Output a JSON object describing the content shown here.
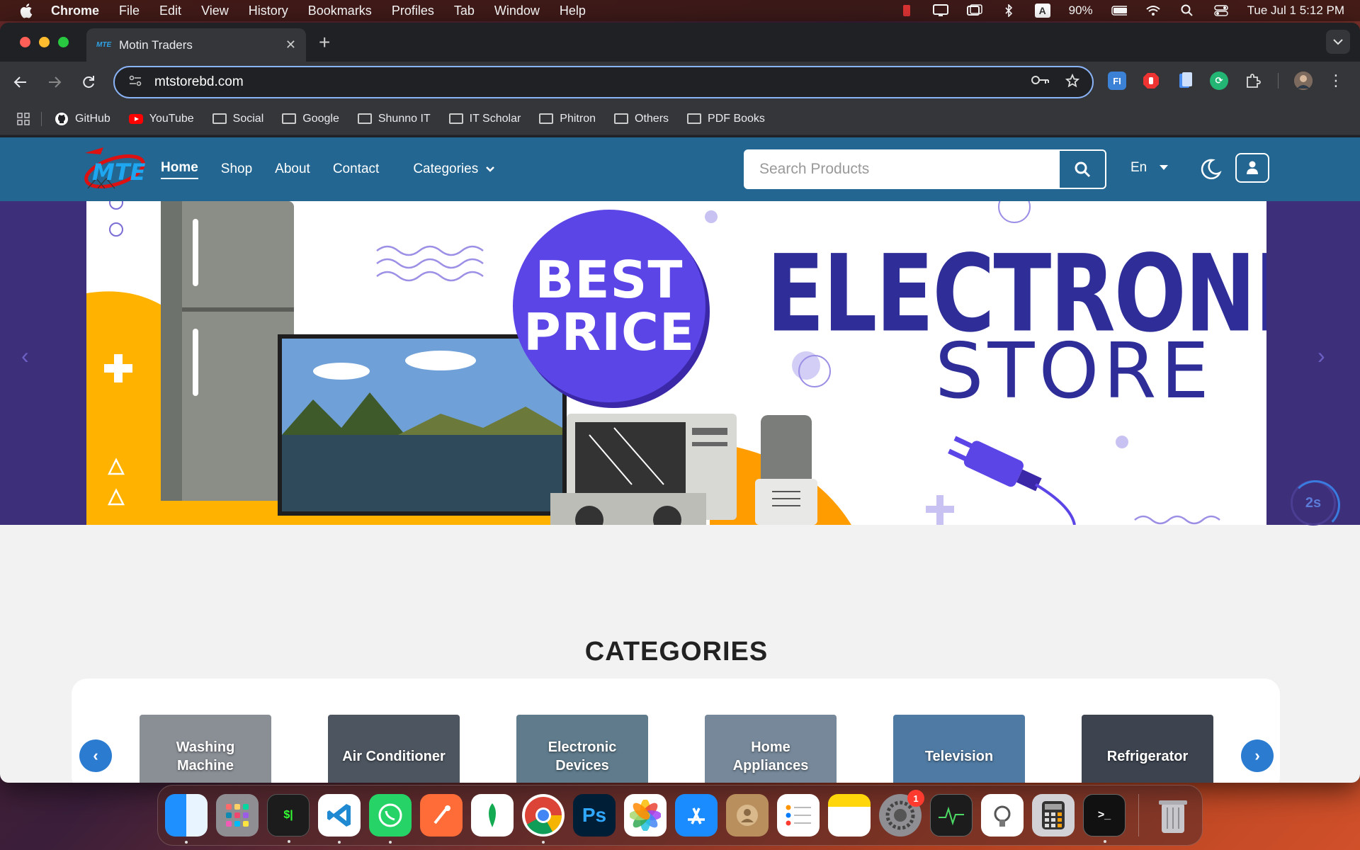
{
  "menubar": {
    "app_name": "Chrome",
    "items": [
      "File",
      "Edit",
      "View",
      "History",
      "Bookmarks",
      "Profiles",
      "Tab",
      "Window",
      "Help"
    ],
    "battery": "90%",
    "datetime": "Tue Jul 1  5:12 PM"
  },
  "browser": {
    "tab_title": "Motin Traders",
    "favicon_text": "MTE",
    "url": "mtstorebd.com",
    "bookmarks": [
      "GitHub",
      "YouTube",
      "Social",
      "Google",
      "Shunno IT",
      "IT Scholar",
      "Phitron",
      "Others",
      "PDF Books"
    ]
  },
  "site": {
    "logo_text": "MTE",
    "nav": [
      "Home",
      "Shop",
      "About",
      "Contact"
    ],
    "categories_label": "Categories",
    "search_placeholder": "Search Products",
    "language": "En"
  },
  "hero": {
    "badge_line1": "BEST",
    "badge_line2": "PRICE",
    "title": "ELECTRONICS",
    "subtitle": "STORE",
    "timer": "2s"
  },
  "categories": {
    "heading": "CATEGORIES",
    "items": [
      {
        "label": "Washing Machine",
        "color": "#8a8f96"
      },
      {
        "label": "Air Conditioner",
        "color": "#4d5560"
      },
      {
        "label": "Electronic Devices",
        "color": "#5f7b8c"
      },
      {
        "label": "Home Appliances",
        "color": "#76889a"
      },
      {
        "label": "Television",
        "color": "#4f7aa3"
      },
      {
        "label": "Refrigerator",
        "color": "#3d4450"
      }
    ]
  },
  "colors": {
    "header": "#226691",
    "accent": "#2b7bd1",
    "hero_purple": "#5b45e6",
    "hero_text": "#2f2e99"
  },
  "dock": {
    "badge_count": "1"
  }
}
